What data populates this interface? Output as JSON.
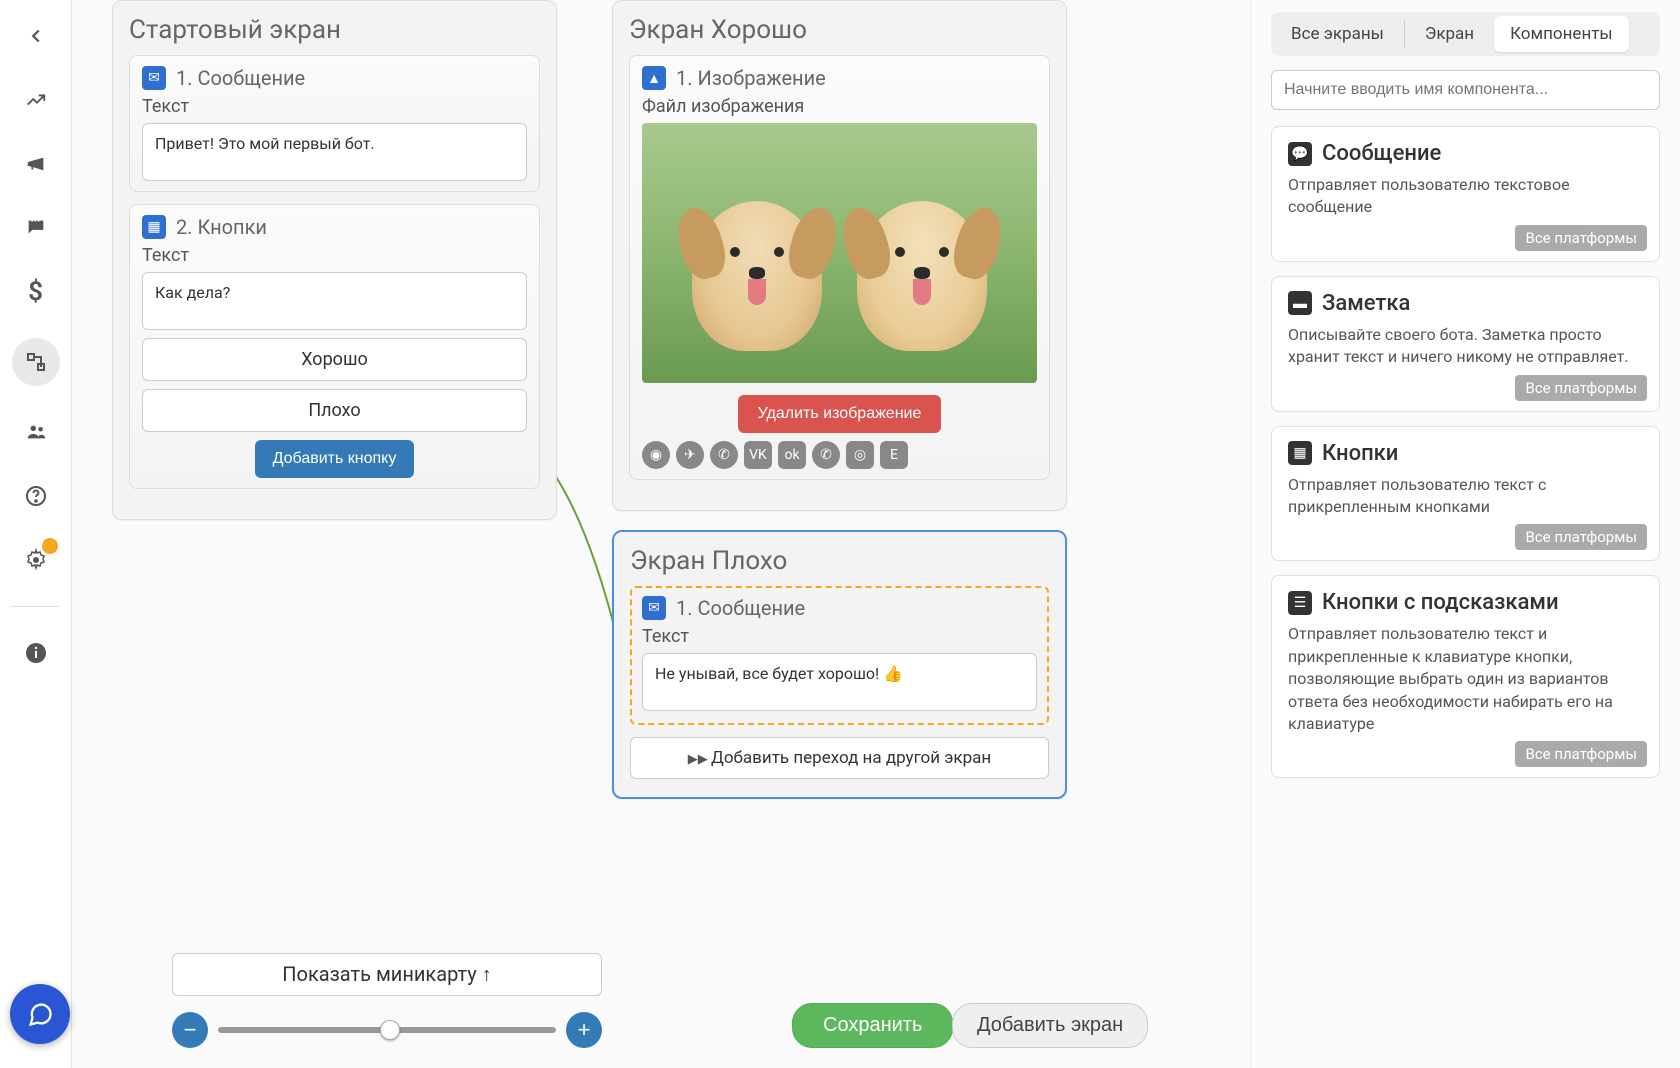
{
  "sidebar": {
    "icons": [
      "back",
      "chart",
      "megaphone",
      "chat",
      "dollar",
      "flowchart",
      "users",
      "help",
      "settings",
      "info"
    ]
  },
  "chat_fab": "chat",
  "screens": {
    "start": {
      "title": "Стартовый экран",
      "msg": {
        "head": "1. Сообщение",
        "label": "Текст",
        "value": "Привет! Это мой первый бот."
      },
      "buttons": {
        "head": "2. Кнопки",
        "label": "Текст",
        "value": "Как дела?",
        "opts": [
          "Хорошо",
          "Плохо"
        ],
        "add": "Добавить кнопку"
      }
    },
    "good": {
      "title": "Экран Хорошо",
      "img": {
        "head": "1. Изображение",
        "label": "Файл изображения",
        "delete": "Удалить изображение"
      },
      "platforms": [
        "fb",
        "tg",
        "vb",
        "vk",
        "ok",
        "wa",
        "ig",
        "em"
      ]
    },
    "bad": {
      "title": "Экран Плохо",
      "msg": {
        "head": "1. Сообщение",
        "label": "Текст",
        "value": "Не унывай, все будет хорошо! 👍"
      },
      "add_transition": "Добавить переход на другой экран"
    }
  },
  "bottom": {
    "minimap": "Показать миникарту ↑",
    "save": "Сохранить",
    "add_screen": "Добавить экран"
  },
  "right": {
    "tabs": [
      "Все экраны",
      "Экран",
      "Компоненты"
    ],
    "search_placeholder": "Начните вводить имя компонента...",
    "badge": "Все платформы",
    "components": [
      {
        "title": "Сообщение",
        "desc": "Отправляет пользователю текстовое сообщение"
      },
      {
        "title": "Заметка",
        "desc": "Описывайте своего бота. Заметка просто хранит текст и ничего никому не отправляет."
      },
      {
        "title": "Кнопки",
        "desc": "Отправляет пользователю текст с прикрепленным кнопками"
      },
      {
        "title": "Кнопки с подсказками",
        "desc": "Отправляет пользователю текст и прикрепленные к клавиатуре кнопки, позволяющие выбрать один из вариантов ответа без необходимости набирать его на клавиатуре"
      }
    ]
  }
}
